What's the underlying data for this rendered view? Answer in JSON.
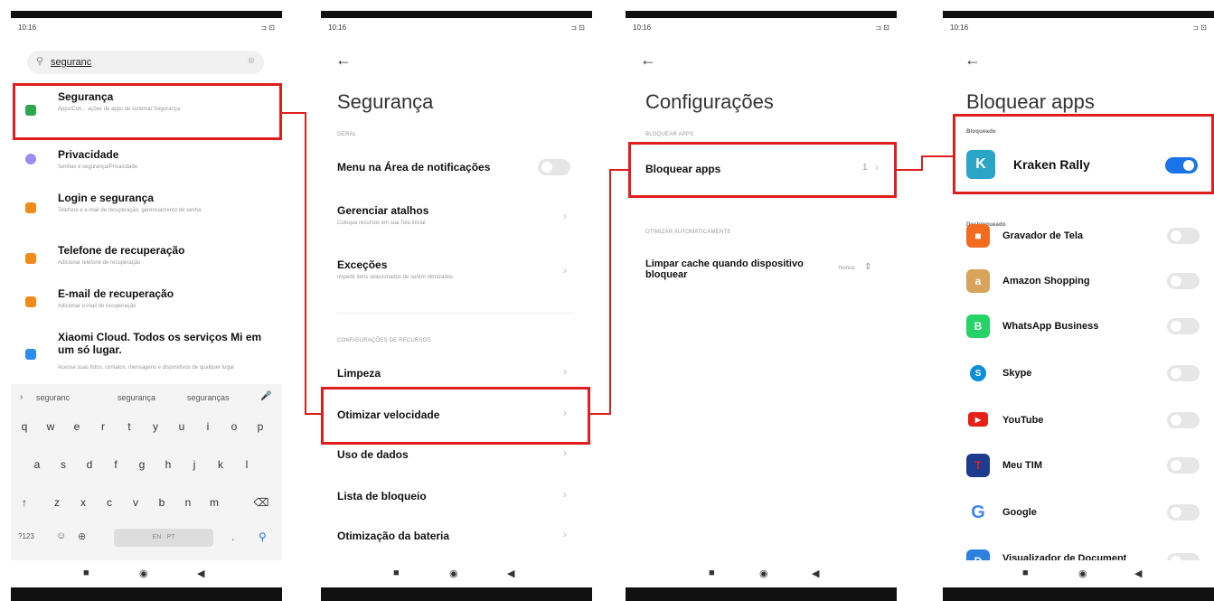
{
  "status": {
    "time": "10:16",
    "battery": "⊐ ⊡"
  },
  "panel1": {
    "search_value": "seguranc",
    "results": [
      {
        "title": "Segurança",
        "sub": "Apps/Con... ações de apps de sistema/ Segurança",
        "color": "#2ea84f"
      },
      {
        "title": "Privacidade",
        "sub": "Senhas e segurança/Privacidade",
        "color": "#9a8cf0"
      },
      {
        "title": "Login e segurança",
        "sub": "Telefone e e-mail de recuperação, gerenciamento de senha",
        "color": "#f28b1a"
      },
      {
        "title": "Telefone de recuperação",
        "sub": "Adicionar telefone de recuperação",
        "color": "#f28b1a"
      },
      {
        "title": "E-mail de recuperação",
        "sub": "Adicionar e-mail de recuperação",
        "color": "#f28b1a"
      },
      {
        "title": "Xiaomi Cloud. Todos os serviços Mi em um só lugar.",
        "sub": "Acesse suas fotos, contatos, mensagens e dispositivos de qualquer lugar",
        "color": "#2d8cf0"
      }
    ],
    "suggestions": [
      "seguranc",
      "segurança",
      "seguranças"
    ],
    "keys_row1": [
      "q",
      "w",
      "e",
      "r",
      "t",
      "y",
      "u",
      "i",
      "o",
      "p"
    ],
    "keys_row2": [
      "a",
      "s",
      "d",
      "f",
      "g",
      "h",
      "j",
      "k",
      "l"
    ],
    "keys_row3": [
      "↑",
      "z",
      "x",
      "c",
      "v",
      "b",
      "n",
      "m",
      "⌫"
    ],
    "key_num": "?123",
    "key_space": "EN · PT",
    "key_dot": "."
  },
  "panel2": {
    "title": "Segurança",
    "section_geral": "GERAL",
    "items_geral": [
      {
        "title": "Menu na Área de notificações",
        "sub": ""
      },
      {
        "title": "Gerenciar atalhos",
        "sub": "Coloque recursos em sua Tela inicial"
      },
      {
        "title": "Exceções",
        "sub": "Impedir itens selecionados de serem otimizados"
      }
    ],
    "section_recursos": "CONFIGURAÇÕES DE RECURSOS",
    "items_recursos": [
      "Limpeza",
      "Otimizar velocidade",
      "Uso de dados",
      "Lista de bloqueio",
      "Otimização da bateria"
    ]
  },
  "panel3": {
    "title": "Configurações",
    "section_bloquear": "BLOQUEAR APPS",
    "bloquear_label": "Bloquear apps",
    "bloquear_count": "1",
    "section_otimizar": "OTIMIZAR AUTOMATICAMENTE",
    "limpar_label": "Limpar cache quando dispositivo bloquear",
    "limpar_value": "Nunca"
  },
  "panel4": {
    "title": "Bloquear apps",
    "section_bloqueado": "Bloqueado",
    "locked_app": "Kraken Rally",
    "section_desbloqueado": "Desbloqueado",
    "apps": [
      {
        "name": "Gravador de Tela",
        "color": "#f36b21",
        "glyph": "■"
      },
      {
        "name": "Amazon Shopping",
        "color": "#d8a35a",
        "glyph": "a"
      },
      {
        "name": "WhatsApp Business",
        "color": "#25d366",
        "glyph": "B"
      },
      {
        "name": "Skype",
        "color": "#0a8fd8",
        "glyph": "S"
      },
      {
        "name": "YouTube",
        "color": "#e62117",
        "glyph": "▶"
      },
      {
        "name": "Meu TIM",
        "color": "#1d3b8f",
        "glyph": "T"
      },
      {
        "name": "Google",
        "color": "#4285f4",
        "glyph": "G"
      },
      {
        "name": "Visualizador de Document",
        "color": "#2d7fe0",
        "glyph": "D"
      }
    ]
  }
}
